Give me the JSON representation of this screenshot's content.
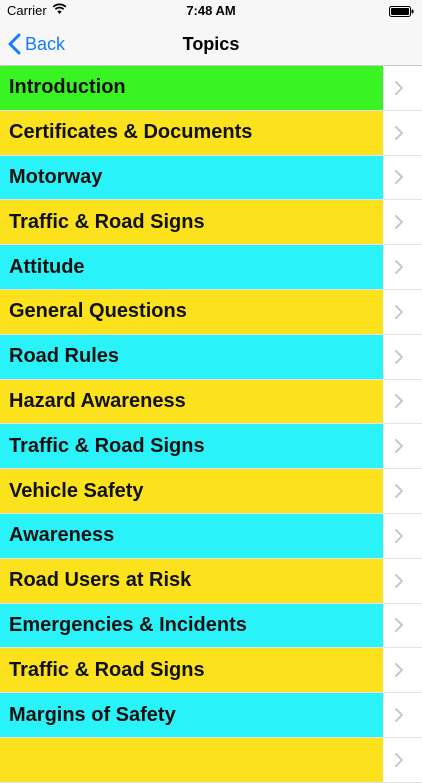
{
  "status": {
    "carrier": "Carrier",
    "time": "7:48 AM"
  },
  "nav": {
    "back_label": "Back",
    "title": "Topics"
  },
  "colors": {
    "accent": "#147efb",
    "green": "#39f322",
    "yellow": "#fbe21c",
    "cyan": "#29f2f9"
  },
  "topics": [
    {
      "label": "Introduction",
      "color": "#39f322"
    },
    {
      "label": "Certificates & Documents",
      "color": "#fbe21c"
    },
    {
      "label": "Motorway",
      "color": "#29f2f9"
    },
    {
      "label": "Traffic & Road Signs",
      "color": "#fbe21c"
    },
    {
      "label": "Attitude",
      "color": "#29f2f9"
    },
    {
      "label": "General Questions",
      "color": "#fbe21c"
    },
    {
      "label": "Road Rules",
      "color": "#29f2f9"
    },
    {
      "label": "Hazard Awareness",
      "color": "#fbe21c"
    },
    {
      "label": "Traffic & Road Signs",
      "color": "#29f2f9"
    },
    {
      "label": "Vehicle Safety",
      "color": "#fbe21c"
    },
    {
      "label": "Awareness",
      "color": "#29f2f9"
    },
    {
      "label": "Road Users at Risk",
      "color": "#fbe21c"
    },
    {
      "label": "Emergencies & Incidents",
      "color": "#29f2f9"
    },
    {
      "label": "Traffic & Road Signs",
      "color": "#fbe21c"
    },
    {
      "label": "Margins of Safety",
      "color": "#29f2f9"
    },
    {
      "label": "",
      "color": "#fbe21c"
    }
  ]
}
